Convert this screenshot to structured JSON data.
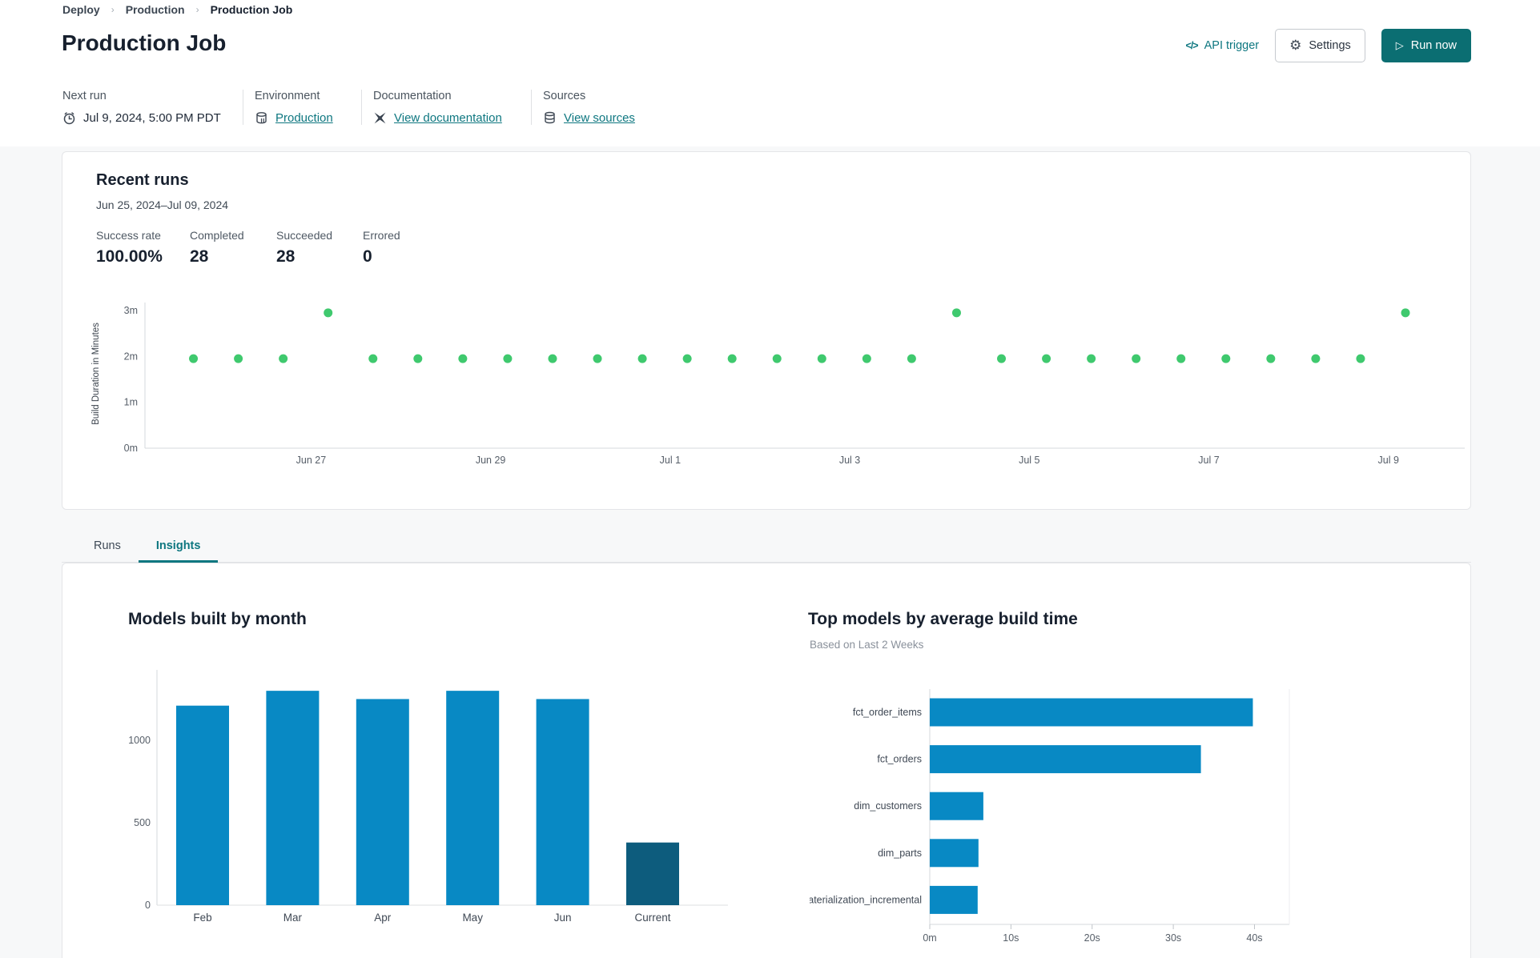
{
  "breadcrumb": {
    "items": [
      "Deploy",
      "Production",
      "Production Job"
    ]
  },
  "header": {
    "title": "Production Job",
    "api_trigger": {
      "label": "API trigger",
      "icon_text": "</>"
    },
    "settings": {
      "label": "Settings"
    },
    "run_now": {
      "label": "Run now"
    }
  },
  "meta": {
    "columns": [
      {
        "label": "Next run",
        "value": "Jul 9, 2024, 5:00 PM PDT",
        "icon": "clock-icon",
        "is_link": false
      },
      {
        "label": "Environment",
        "value": "Production",
        "icon": "environment-icon",
        "is_link": true
      },
      {
        "label": "Documentation",
        "value": "View documentation",
        "icon": "dbt-docs-icon",
        "is_link": true
      },
      {
        "label": "Sources",
        "value": "View sources",
        "icon": "database-icon",
        "is_link": true
      }
    ]
  },
  "recent_runs": {
    "title": "Recent runs",
    "date_range": "Jun 25, 2024–Jul 09, 2024",
    "stats": [
      {
        "label": "Success rate",
        "value": "100.00%"
      },
      {
        "label": "Completed",
        "value": "28"
      },
      {
        "label": "Succeeded",
        "value": "28"
      },
      {
        "label": "Errored",
        "value": "0"
      }
    ]
  },
  "tabs": [
    {
      "label": "Runs",
      "active": false
    },
    {
      "label": "Insights",
      "active": true
    }
  ],
  "colors": {
    "accent_teal": "#0b6e72",
    "link_teal": "#0e7780",
    "success_green": "#3fc96e",
    "bar_blue": "#0889c4",
    "bar_dark_blue": "#0d5c7d"
  },
  "chart_data": [
    {
      "id": "build-duration-scatter",
      "type": "scatter",
      "ylabel": "Build Duration in Minutes",
      "ylim": [
        0,
        3.47
      ],
      "yticks": [
        {
          "value": 0,
          "label": "0m"
        },
        {
          "value": 1,
          "label": "1m"
        },
        {
          "value": 2,
          "label": "2m"
        },
        {
          "value": 3,
          "label": "3m"
        }
      ],
      "x_domain_days": [
        0.15,
        14.85
      ],
      "xticks": [
        {
          "pos": 2,
          "label": "Jun 27"
        },
        {
          "pos": 4,
          "label": "Jun 29"
        },
        {
          "pos": 6,
          "label": "Jul 1"
        },
        {
          "pos": 8,
          "label": "Jul 3"
        },
        {
          "pos": 10,
          "label": "Jul 5"
        },
        {
          "pos": 12,
          "label": "Jul 7"
        },
        {
          "pos": 14,
          "label": "Jul 9"
        }
      ],
      "point_color": "#3fc96e",
      "points": [
        {
          "day": 0.69,
          "minutes": 1.95
        },
        {
          "day": 1.19,
          "minutes": 1.95
        },
        {
          "day": 1.69,
          "minutes": 1.95
        },
        {
          "day": 2.19,
          "minutes": 2.95
        },
        {
          "day": 2.69,
          "minutes": 1.95
        },
        {
          "day": 3.19,
          "minutes": 1.95
        },
        {
          "day": 3.69,
          "minutes": 1.95
        },
        {
          "day": 4.19,
          "minutes": 1.95
        },
        {
          "day": 4.69,
          "minutes": 1.95
        },
        {
          "day": 5.19,
          "minutes": 1.95
        },
        {
          "day": 5.69,
          "minutes": 1.95
        },
        {
          "day": 6.19,
          "minutes": 1.95
        },
        {
          "day": 6.69,
          "minutes": 1.95
        },
        {
          "day": 7.19,
          "minutes": 1.95
        },
        {
          "day": 7.69,
          "minutes": 1.95
        },
        {
          "day": 8.19,
          "minutes": 1.95
        },
        {
          "day": 8.69,
          "minutes": 1.95
        },
        {
          "day": 9.19,
          "minutes": 2.95
        },
        {
          "day": 9.69,
          "minutes": 1.95
        },
        {
          "day": 10.19,
          "minutes": 1.95
        },
        {
          "day": 10.69,
          "minutes": 1.95
        },
        {
          "day": 11.19,
          "minutes": 1.95
        },
        {
          "day": 11.69,
          "minutes": 1.95
        },
        {
          "day": 12.19,
          "minutes": 1.95
        },
        {
          "day": 12.69,
          "minutes": 1.95
        },
        {
          "day": 13.19,
          "minutes": 1.95
        },
        {
          "day": 13.69,
          "minutes": 1.95
        },
        {
          "day": 14.19,
          "minutes": 2.95
        }
      ]
    },
    {
      "id": "models-built-by-month",
      "type": "bar",
      "title": "Models built by month",
      "categories": [
        "Feb",
        "Mar",
        "Apr",
        "May",
        "Jun",
        "Current"
      ],
      "values": [
        1210,
        1300,
        1250,
        1300,
        1250,
        380
      ],
      "yticks": [
        0,
        500,
        1000
      ],
      "ylim": [
        0,
        1456
      ],
      "bar_color": "#0889c4",
      "highlight_index": 5,
      "highlight_color": "#0d5c7d"
    },
    {
      "id": "top-models-build-time",
      "type": "horizontal-bar",
      "title": "Top models by average build time",
      "subtitle": "Based on Last 2 Weeks",
      "categories": [
        "fct_order_items",
        "fct_orders",
        "dim_customers",
        "dim_parts",
        "materialization_incremental"
      ],
      "values_seconds": [
        39.8,
        33.4,
        6.6,
        6.0,
        5.9
      ],
      "xticks": [
        {
          "value": 0,
          "label": "0m"
        },
        {
          "value": 10,
          "label": "10s"
        },
        {
          "value": 20,
          "label": "20s"
        },
        {
          "value": 30,
          "label": "30s"
        },
        {
          "value": 40,
          "label": "40s"
        }
      ],
      "xlim_seconds": [
        0,
        43.8
      ],
      "bar_color": "#0889c4"
    }
  ]
}
